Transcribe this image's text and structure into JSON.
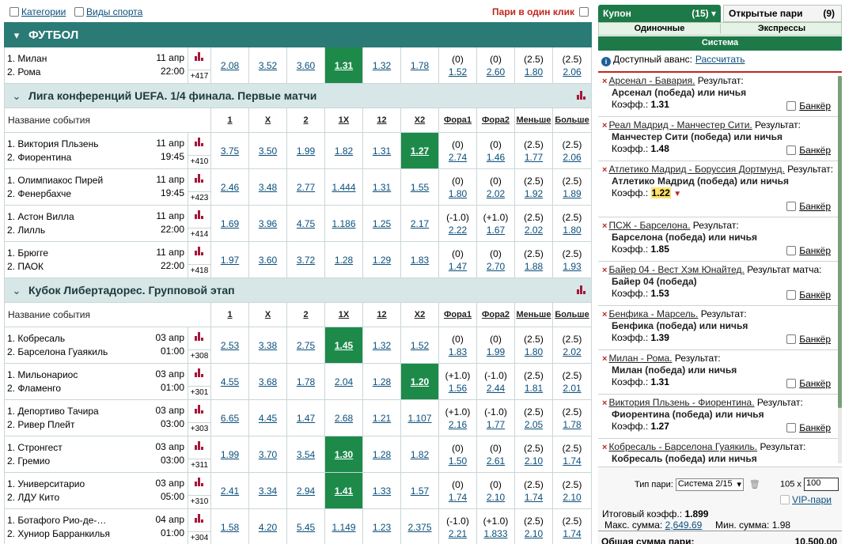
{
  "top": {
    "categories": "Категории",
    "sports": "Виды спорта",
    "oneclick": "Пари в один клик"
  },
  "sport": {
    "name": "ФУТБОЛ"
  },
  "topmatch": {
    "team1": "1. Милан",
    "team2": "2. Рома",
    "date": "11 апр",
    "time": "22:00",
    "more": "+417",
    "odds": [
      "2.08",
      "3.52",
      "3.60",
      "1.31",
      "1.32",
      "1.78"
    ],
    "hl": 3,
    "f1": [
      "(0)",
      "1.52"
    ],
    "f2": [
      "(0)",
      "2.60"
    ],
    "less": [
      "(2.5)",
      "1.80"
    ],
    "more_t": [
      "(2.5)",
      "2.06"
    ]
  },
  "headers": {
    "name": "Название события",
    "c1": "1",
    "cx": "X",
    "c2": "2",
    "c1x": "1X",
    "c12": "12",
    "cx2": "X2",
    "f1": "Фора1",
    "f2": "Фора2",
    "less": "Меньше",
    "more": "Больше"
  },
  "leagues": [
    {
      "name": "Лига конференций UEFA. 1/4 финала. Первые матчи",
      "matches": [
        {
          "team1": "1. Виктория Пльзень",
          "team2": "2. Фиорентина",
          "date": "11 апр",
          "time": "19:45",
          "more": "+410",
          "odds": [
            "3.75",
            "3.50",
            "1.99",
            "1.82",
            "1.31",
            "1.27"
          ],
          "hl": 5,
          "f1": [
            "(0)",
            "2.74"
          ],
          "f2": [
            "(0)",
            "1.46"
          ],
          "less": [
            "(2.5)",
            "1.77"
          ],
          "more_t": [
            "(2.5)",
            "2.06"
          ]
        },
        {
          "team1": "1. Олимпиакос Пирей",
          "team2": "2. Фенербахче",
          "date": "11 апр",
          "time": "19:45",
          "more": "+423",
          "odds": [
            "2.46",
            "3.48",
            "2.77",
            "1.444",
            "1.31",
            "1.55"
          ],
          "hl": -1,
          "f1": [
            "(0)",
            "1.80"
          ],
          "f2": [
            "(0)",
            "2.02"
          ],
          "less": [
            "(2.5)",
            "1.92"
          ],
          "more_t": [
            "(2.5)",
            "1.89"
          ]
        },
        {
          "team1": "1. Астон Вилла",
          "team2": "2. Лилль",
          "date": "11 апр",
          "time": "22:00",
          "more": "+414",
          "odds": [
            "1.69",
            "3.96",
            "4.75",
            "1.186",
            "1.25",
            "2.17"
          ],
          "hl": -1,
          "f1": [
            "(-1.0)",
            "2.22"
          ],
          "f2": [
            "(+1.0)",
            "1.67"
          ],
          "less": [
            "(2.5)",
            "2.02"
          ],
          "more_t": [
            "(2.5)",
            "1.80"
          ]
        },
        {
          "team1": "1. Брюгге",
          "team2": "2. ПАОК",
          "date": "11 апр",
          "time": "22:00",
          "more": "+418",
          "odds": [
            "1.97",
            "3.60",
            "3.72",
            "1.28",
            "1.29",
            "1.83"
          ],
          "hl": -1,
          "f1": [
            "(0)",
            "1.47"
          ],
          "f2": [
            "(0)",
            "2.70"
          ],
          "less": [
            "(2.5)",
            "1.88"
          ],
          "more_t": [
            "(2.5)",
            "1.93"
          ]
        }
      ]
    },
    {
      "name": "Кубок Либертадорес. Групповой этап",
      "matches": [
        {
          "team1": "1. Кобресаль",
          "team2": "2. Барселона Гуаякиль",
          "date": "03 апр",
          "time": "01:00",
          "more": "+308",
          "odds": [
            "2.53",
            "3.38",
            "2.75",
            "1.45",
            "1.32",
            "1.52"
          ],
          "hl": 3,
          "f1": [
            "(0)",
            "1.83"
          ],
          "f2": [
            "(0)",
            "1.99"
          ],
          "less": [
            "(2.5)",
            "1.80"
          ],
          "more_t": [
            "(2.5)",
            "2.02"
          ]
        },
        {
          "team1": "1. Мильонариос",
          "team2": "2. Фламенго",
          "date": "03 апр",
          "time": "01:00",
          "more": "+301",
          "odds": [
            "4.55",
            "3.68",
            "1.78",
            "2.04",
            "1.28",
            "1.20"
          ],
          "hl": 5,
          "f1": [
            "(+1.0)",
            "1.56"
          ],
          "f2": [
            "(-1.0)",
            "2.44"
          ],
          "less": [
            "(2.5)",
            "1.81"
          ],
          "more_t": [
            "(2.5)",
            "2.01"
          ]
        },
        {
          "team1": "1. Депортиво Тачира",
          "team2": "2. Ривер Плейт",
          "date": "03 апр",
          "time": "03:00",
          "more": "+303",
          "odds": [
            "6.65",
            "4.45",
            "1.47",
            "2.68",
            "1.21",
            "1.107"
          ],
          "hl": -1,
          "f1": [
            "(+1.0)",
            "2.16"
          ],
          "f2": [
            "(-1.0)",
            "1.77"
          ],
          "less": [
            "(2.5)",
            "2.05"
          ],
          "more_t": [
            "(2.5)",
            "1.78"
          ]
        },
        {
          "team1": "1. Стронгест",
          "team2": "2. Гремио",
          "date": "03 апр",
          "time": "03:00",
          "more": "+311",
          "odds": [
            "1.99",
            "3.70",
            "3.54",
            "1.30",
            "1.28",
            "1.82"
          ],
          "hl": 3,
          "f1": [
            "(0)",
            "1.50"
          ],
          "f2": [
            "(0)",
            "2.61"
          ],
          "less": [
            "(2.5)",
            "2.10"
          ],
          "more_t": [
            "(2.5)",
            "1.74"
          ]
        },
        {
          "team1": "1. Университарио",
          "team2": "2. ЛДУ Кито",
          "date": "03 апр",
          "time": "05:00",
          "more": "+310",
          "odds": [
            "2.41",
            "3.34",
            "2.94",
            "1.41",
            "1.33",
            "1.57"
          ],
          "hl": 3,
          "f1": [
            "(0)",
            "1.74"
          ],
          "f2": [
            "(0)",
            "2.10"
          ],
          "less": [
            "(2.5)",
            "1.74"
          ],
          "more_t": [
            "(2.5)",
            "2.10"
          ]
        },
        {
          "team1": "1. Ботафого Рио-де-…",
          "team2": "2. Хуниор Барранкилья",
          "date": "04 апр",
          "time": "01:00",
          "more": "+304",
          "odds": [
            "1.58",
            "4.20",
            "5.45",
            "1.149",
            "1.23",
            "2.375"
          ],
          "hl": -1,
          "f1": [
            "(-1.0)",
            "2.21"
          ],
          "f2": [
            "(+1.0)",
            "1.833"
          ],
          "less": [
            "(2.5)",
            "2.10"
          ],
          "more_t": [
            "(2.5)",
            "1.74"
          ]
        }
      ]
    }
  ],
  "coupon": {
    "tab_coupon": "Купон",
    "tab_coupon_count": "(15)",
    "tab_open": "Открытые пари",
    "tab_open_count": "(9)",
    "single": "Одиночные",
    "express": "Экспрессы",
    "system": "Система",
    "avans_label": "Доступный аванс:",
    "avans_link": "Рассчитать",
    "bets": [
      {
        "event": "Арсенал - Бавария.",
        "suffix": "Результат:",
        "outcome": "Арсенал (победа) или ничья",
        "k": "1.31"
      },
      {
        "event": "Реал Мадрид - Манчестер Сити.",
        "suffix": "Результат:",
        "outcome": "Манчестер Сити (победа) или ничья",
        "k": "1.48"
      },
      {
        "event": "Атлетико Мадрид - Боруссия Дортмунд.",
        "suffix": "Результат:",
        "outcome": "Атлетико Мадрид (победа) или ничья",
        "k": "1.22",
        "changed": true
      },
      {
        "event": "ПСЖ - Барселона.",
        "suffix": "Результат:",
        "outcome": "Барселона (победа) или ничья",
        "k": "1.85"
      },
      {
        "event": "Байер 04 - Вест Хэм Юнайтед.",
        "suffix": "Результат матча:",
        "outcome": "Байер 04 (победа)",
        "k": "1.53"
      },
      {
        "event": "Бенфика - Марсель.",
        "suffix": "Результат:",
        "outcome": "Бенфика (победа) или ничья",
        "k": "1.39"
      },
      {
        "event": "Милан - Рома.",
        "suffix": "Результат:",
        "outcome": "Милан (победа) или ничья",
        "k": "1.31"
      },
      {
        "event": "Виктория Пльзень - Фиорентина.",
        "suffix": "Результат:",
        "outcome": "Фиорентина (победа) или ничья",
        "k": "1.27"
      },
      {
        "event": "Кобресаль - Барселона Гуаякиль.",
        "suffix": "Результат:",
        "outcome": "Кобресаль (победа) или ничья",
        "k": ""
      }
    ],
    "coef_label": "Коэфф.:",
    "banker": "Банкёр",
    "bet_type_label": "Тип пари:",
    "bet_type_value": "Система 2/15",
    "multiplier": "105 x",
    "stake": "100",
    "vip": "VIP-пари",
    "total_coef_label": "Итоговый коэфф.:",
    "total_coef": "1.899",
    "max_label": "Макс. сумма:",
    "max_value": "2,649.69",
    "min_label": "Мин. сумма:",
    "min_value": "1.98",
    "sum_label": "Общая сумма пари:",
    "sum_value": "10,500.00"
  },
  "colors": {
    "accent": "#2a7a76",
    "highlight": "#1d8a4a",
    "coupon_green": "#1d7a48",
    "alert": "#c0271e"
  }
}
